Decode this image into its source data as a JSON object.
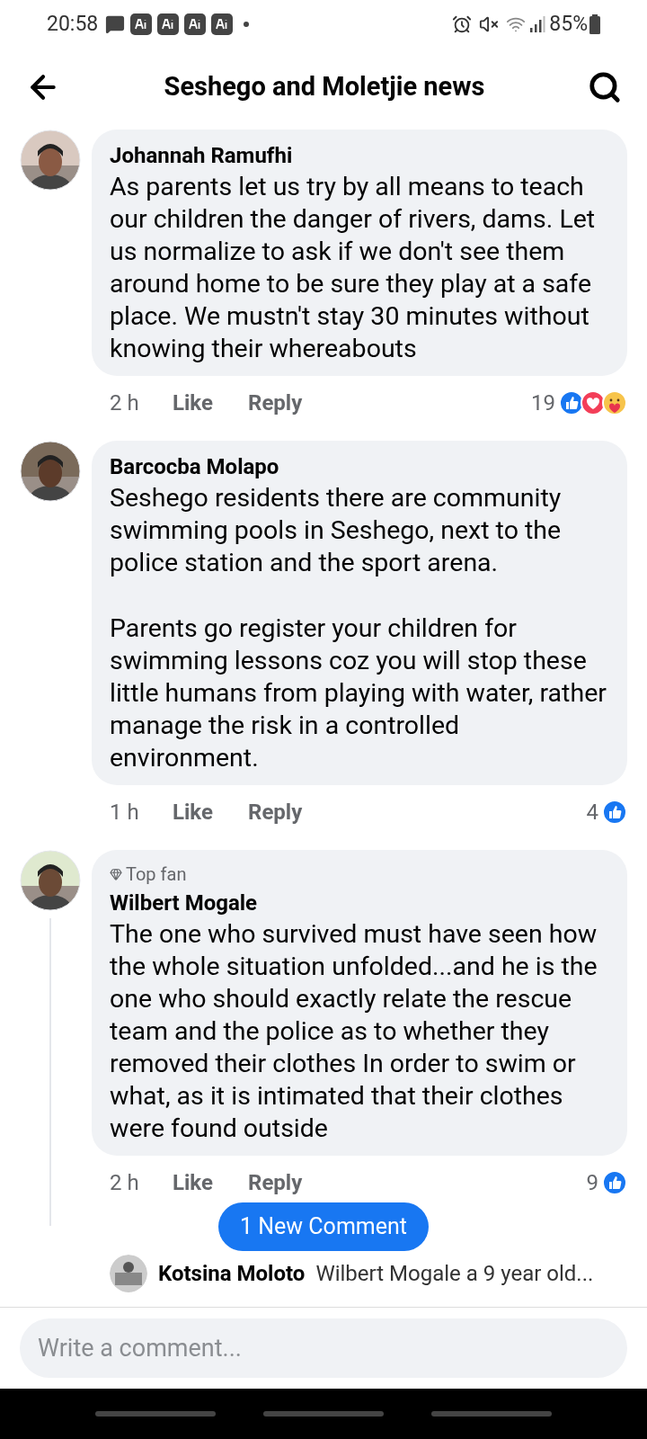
{
  "status_bar": {
    "time": "20:58",
    "battery": "85%"
  },
  "header": {
    "title": "Seshego and Moletjie news"
  },
  "comments": [
    {
      "name": "Johannah Ramufhi",
      "paragraphs": [
        "As parents let us try by all means to teach our children the danger of rivers, dams. Let us normalize to ask if we don't see them around  home to be sure they play at a safe place. We mustn't stay 30 minutes without knowing their whereabouts"
      ],
      "time": "2 h",
      "like": "Like",
      "reply": "Reply",
      "count": "19",
      "reactions": [
        {
          "kind": "like"
        },
        {
          "kind": "love"
        },
        {
          "kind": "care"
        }
      ],
      "has_replies": false
    },
    {
      "name": "Barcocba Molapo",
      "paragraphs": [
        "Seshego residents there are community swimming pools in Seshego, next to the police station and the sport arena.",
        "Parents go register your children for swimming lessons coz you will stop these little humans from playing with water, rather manage the risk in a controlled environment."
      ],
      "time": "1 h",
      "like": "Like",
      "reply": "Reply",
      "count": "4",
      "reactions": [
        {
          "kind": "like"
        }
      ],
      "has_replies": false
    },
    {
      "name": "Wilbert Mogale",
      "badge": "Top fan",
      "paragraphs": [
        "The one who survived must have seen how the whole situation unfolded...and he is the one who should exactly relate the rescue team and the police as to whether they removed their clothes In order to swim or what, as it is intimated that their clothes were found outside"
      ],
      "time": "2 h",
      "like": "Like",
      "reply": "Reply",
      "count": "9",
      "reactions": [
        {
          "kind": "like"
        }
      ],
      "has_replies": true
    }
  ],
  "reply_preview": {
    "name": "Kotsina Moloto",
    "text": "Wilbert Mogale a 9 year old..."
  },
  "new_comment_button": "1 New Comment",
  "composer": {
    "placeholder": "Write a comment..."
  }
}
